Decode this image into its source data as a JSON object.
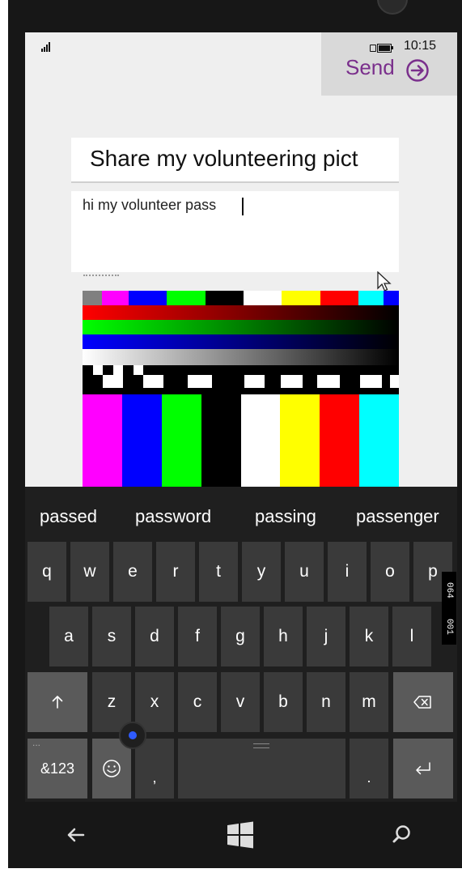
{
  "status_bar": {
    "time": "10:15",
    "icons": [
      "signal-icon",
      "battery-icon"
    ]
  },
  "app_bar": {
    "send_label": "Send",
    "send_icon": "arrow-right-circle-icon",
    "accent_color": "#7a2f8c"
  },
  "compose": {
    "subject": "Share my volunteering pict",
    "body": "hi my volunteer pass"
  },
  "attachment": {
    "image": "color-test-pattern",
    "top_colors": [
      "#808080",
      "#ff00ff",
      "#0000ff",
      "#00ff00",
      "#000000",
      "#ffffff",
      "#ffff00",
      "#ff0000",
      "#00ffff",
      "#0000ff"
    ],
    "bar_colors": [
      "#ff00ff",
      "#0000ff",
      "#00ff00",
      "#000000",
      "#ffffff",
      "#ffff00",
      "#ff0000",
      "#00ffff"
    ]
  },
  "keyboard": {
    "suggestions": [
      "passed",
      "password",
      "passing",
      "passenger"
    ],
    "row1": [
      "q",
      "w",
      "e",
      "r",
      "t",
      "y",
      "u",
      "i",
      "o",
      "p"
    ],
    "row2": [
      "a",
      "s",
      "d",
      "f",
      "g",
      "h",
      "j",
      "k",
      "l"
    ],
    "row3": [
      "z",
      "x",
      "c",
      "v",
      "b",
      "n",
      "m"
    ],
    "shift_icon": "up-arrow-icon",
    "backspace_icon": "backspace-icon",
    "symbols_label": "&123",
    "symbols_sub": "...",
    "emoji_icon": "smiley-icon",
    "comma": ",",
    "period": ".",
    "enter_icon": "enter-icon"
  },
  "side_label": [
    "064",
    "001"
  ],
  "nav_bar": {
    "back_icon": "back-arrow-icon",
    "home_icon": "windows-logo-icon",
    "search_icon": "search-icon"
  }
}
